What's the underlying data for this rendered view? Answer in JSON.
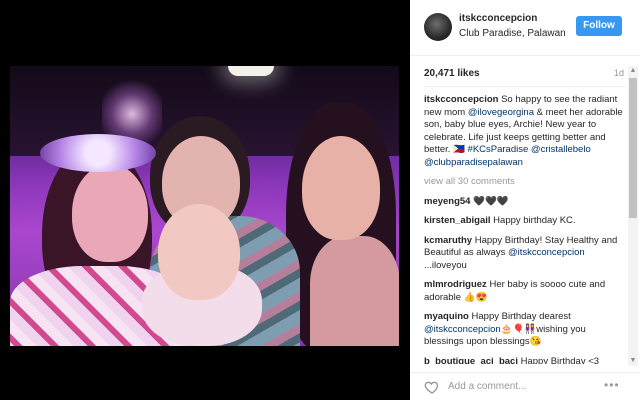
{
  "post": {
    "username": "itskcconcepcion",
    "location": "Club Paradise, Palawan",
    "follow_label": "Follow",
    "likes": "20,471 likes",
    "age": "1d"
  },
  "caption": {
    "user": "itskcconcepcion",
    "text_1": "So happy to see the radiant new mom ",
    "mention_1": "@ilovegeorgina",
    "text_2": " & meet her adorable son, baby blue eyes, Archie! New year to celebrate. Life just keeps getting better and better. ",
    "emoji": "🇵🇭",
    "hashtag": "#KCsParadise",
    "mention_2": "@cristallebelo",
    "mention_3": "@clubparadisepalawan"
  },
  "view_all": "view all 30 comments",
  "comments": [
    {
      "user": "meyeng54",
      "text": "🖤🖤🖤"
    },
    {
      "user": "kirsten_abigail",
      "text": "Happy birthday KC."
    },
    {
      "user": "kcmaruthy",
      "text": "Happy Birthday! Stay Healthy and Beautiful as always ",
      "mention": "@itskcconcepcion",
      "after": " ...iloveyou"
    },
    {
      "user": "mlmrodriguez",
      "text": "Her baby is soooo cute and adorable 👍😍"
    },
    {
      "user": "myaquino",
      "text": "Happy Birthday dearest ",
      "mention": "@itskcconcepcion",
      "after": "🎂🎈👭wishing you blessings upon blessings😘"
    },
    {
      "user": "b_boutique_aci_baci",
      "text": "Happy Birthday <3"
    }
  ],
  "footer": {
    "add_comment_placeholder": "Add a comment...",
    "more_label": "•••"
  },
  "icons": {
    "heart": "heart-icon",
    "scroll_up": "▲",
    "scroll_down": "▼"
  },
  "colors": {
    "follow_blue": "#3897f0",
    "link_blue": "#003569"
  }
}
